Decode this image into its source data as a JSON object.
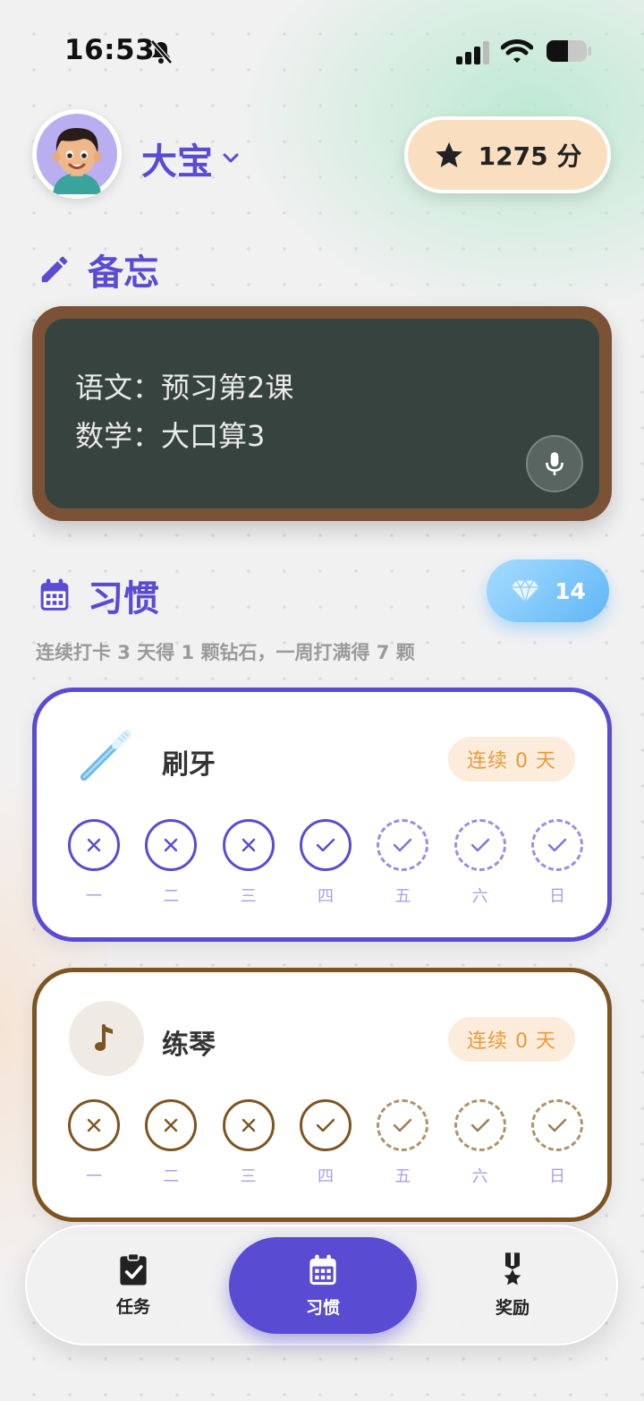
{
  "status_bar": {
    "time": "16:53"
  },
  "header": {
    "username": "大宝",
    "points_label": "1275 分"
  },
  "memo": {
    "title": "备忘",
    "lines": [
      "语文：预习第2课",
      "数学：大口算3"
    ]
  },
  "habits": {
    "title": "习惯",
    "diamond_count": "14",
    "hint": "连续打卡 3 天得 1 颗钻石，一周打满得 7 颗",
    "items": [
      {
        "name": "刷牙",
        "icon": "toothbrush-icon",
        "streak": "连续 0 天",
        "accent": "#5a4bd3",
        "days": [
          {
            "label": "一",
            "state": "missed"
          },
          {
            "label": "二",
            "state": "missed"
          },
          {
            "label": "三",
            "state": "missed"
          },
          {
            "label": "四",
            "state": "done"
          },
          {
            "label": "五",
            "state": "pending"
          },
          {
            "label": "六",
            "state": "pending"
          },
          {
            "label": "日",
            "state": "pending"
          }
        ]
      },
      {
        "name": "练琴",
        "icon": "music-note-icon",
        "streak": "连续 0 天",
        "accent": "#7d5523",
        "days": [
          {
            "label": "一",
            "state": "missed"
          },
          {
            "label": "二",
            "state": "missed"
          },
          {
            "label": "三",
            "state": "missed"
          },
          {
            "label": "四",
            "state": "done"
          },
          {
            "label": "五",
            "state": "pending"
          },
          {
            "label": "六",
            "state": "pending"
          },
          {
            "label": "日",
            "state": "pending"
          }
        ]
      }
    ]
  },
  "nav": {
    "tasks": "任务",
    "habits": "习惯",
    "rewards": "奖励"
  }
}
